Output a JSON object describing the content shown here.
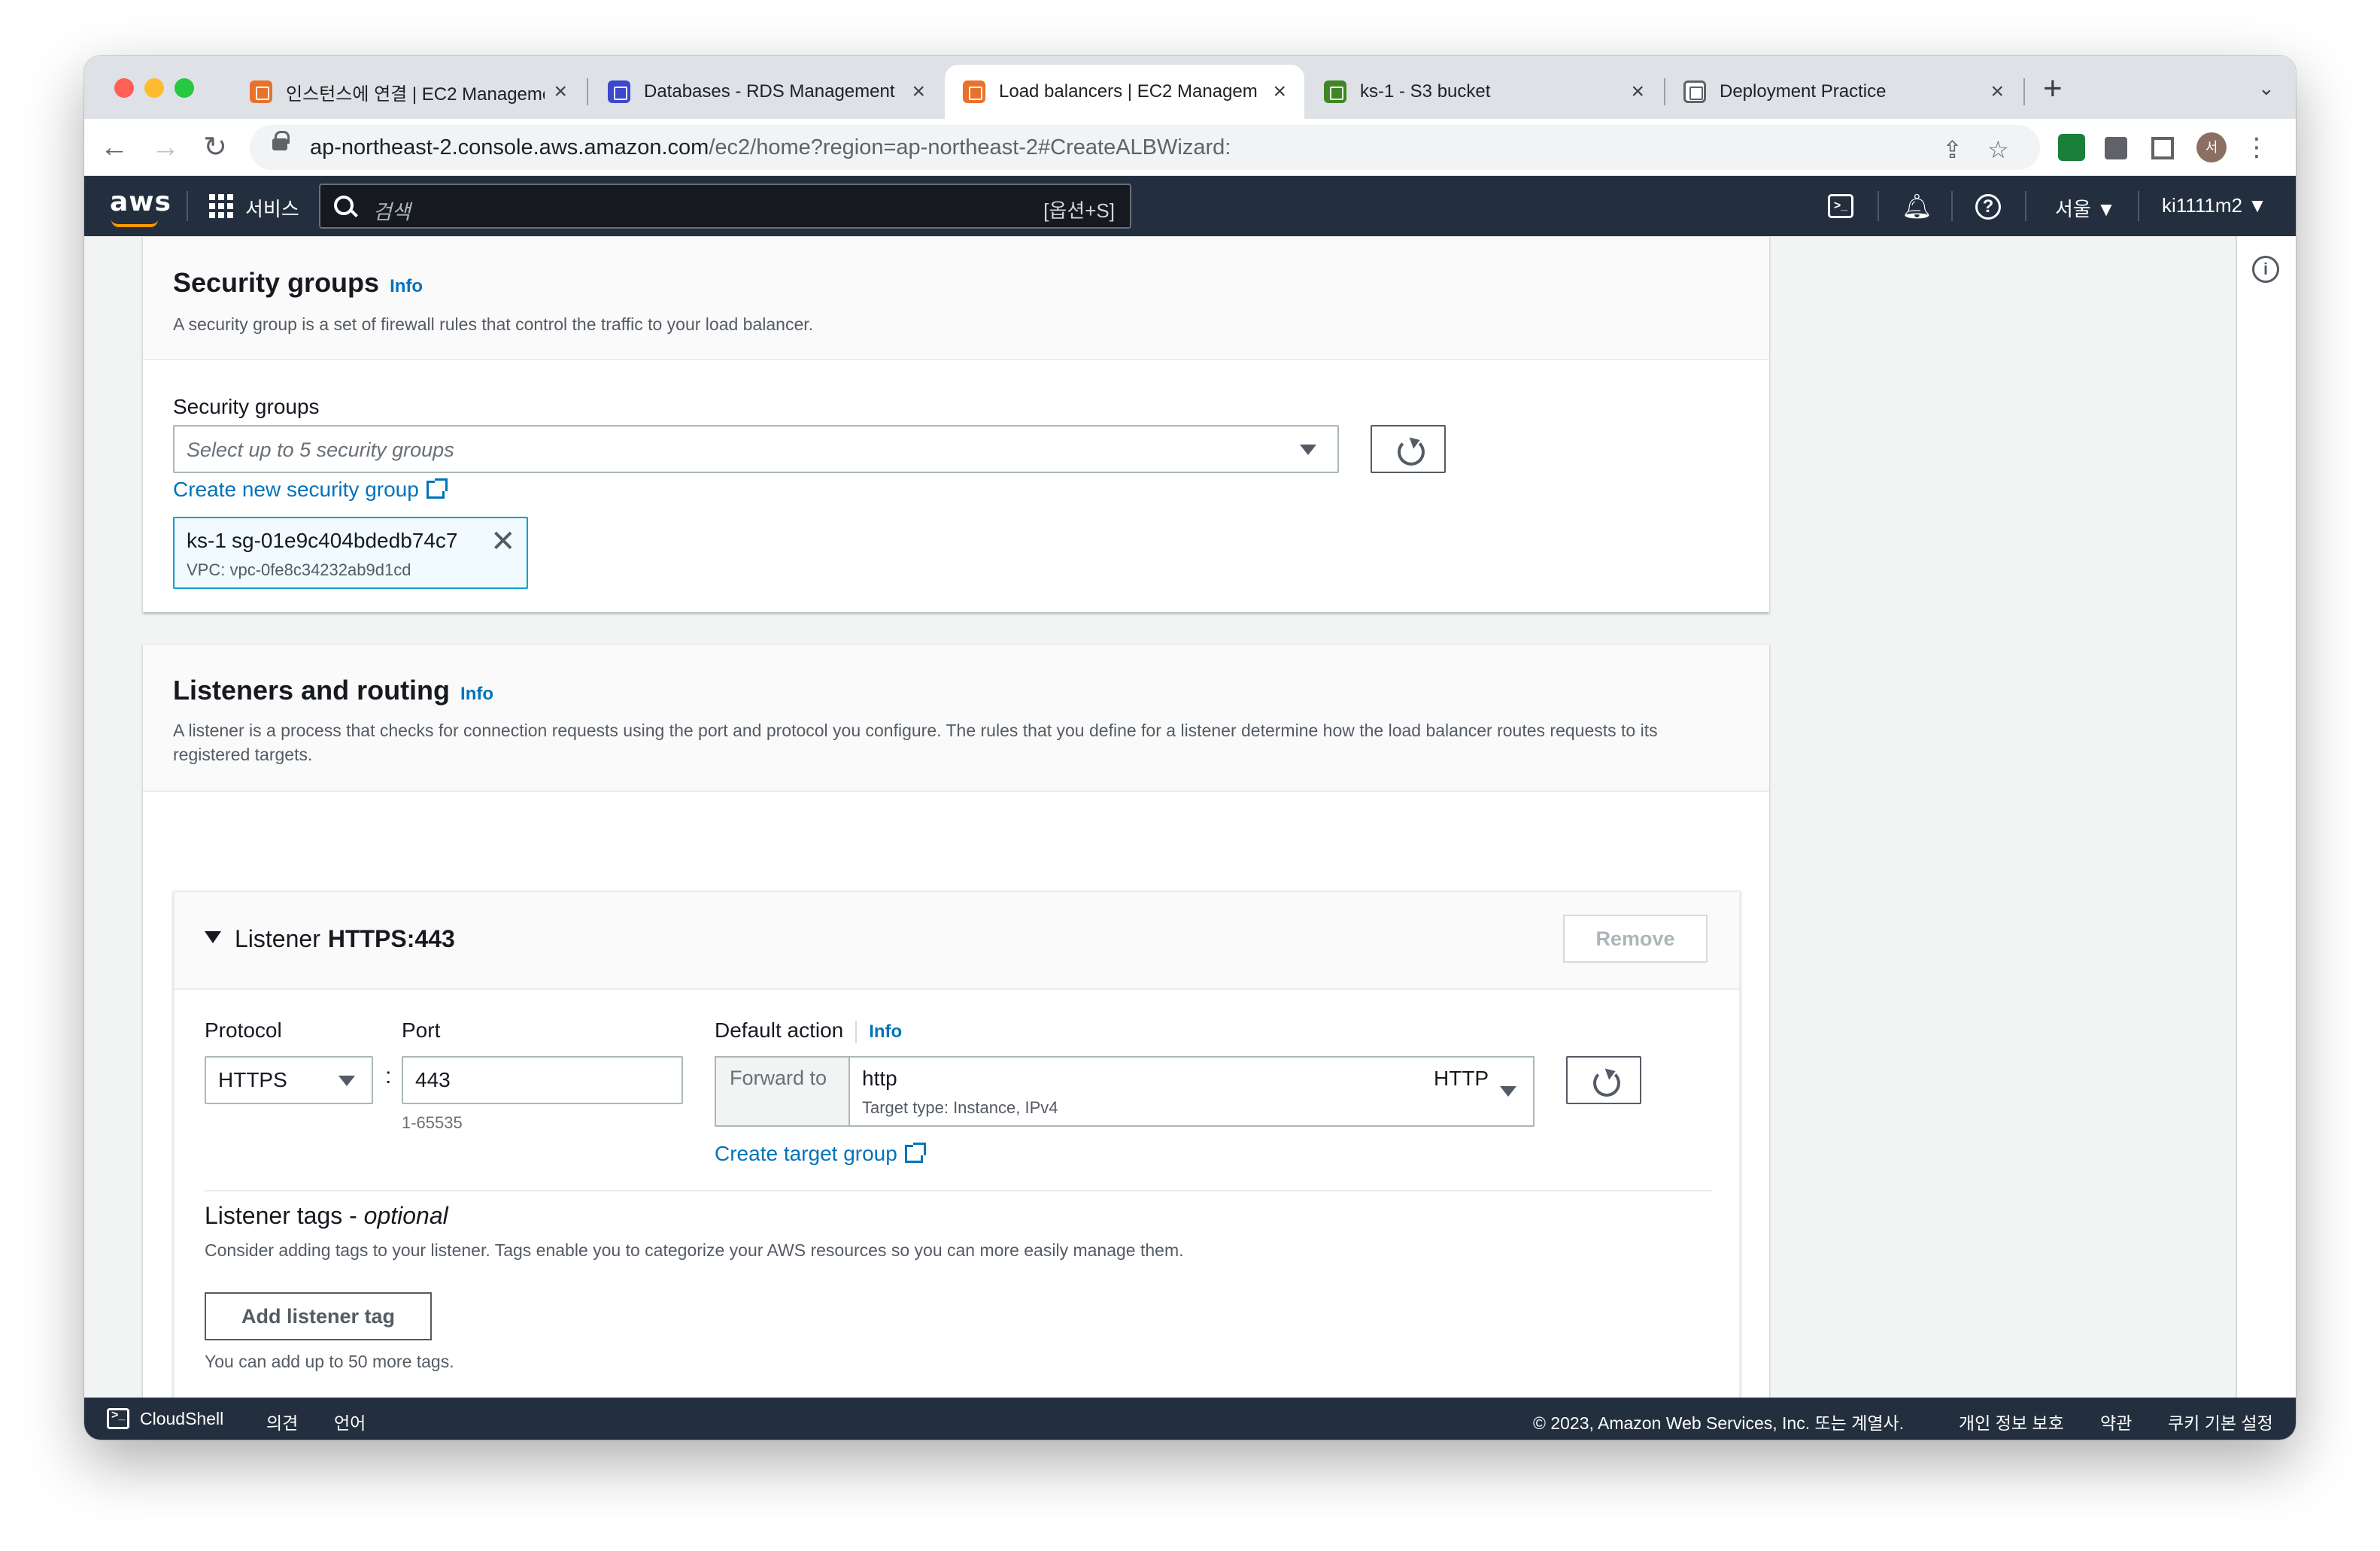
{
  "browser": {
    "tabs": [
      {
        "title": "인스턴스에 연결 | EC2 Manageme",
        "icon": "ec2-favicon"
      },
      {
        "title": "Databases - RDS Management",
        "icon": "rds-favicon"
      },
      {
        "title": "Load balancers | EC2 Managem",
        "icon": "ec2-favicon"
      },
      {
        "title": "ks-1 - S3 bucket",
        "icon": "s3-favicon"
      },
      {
        "title": "Deployment Practice",
        "icon": "doc-favicon"
      }
    ],
    "url_host": "ap-northeast-2.console.aws.amazon.com",
    "url_path": "/ec2/home?region=ap-northeast-2#CreateALBWizard:",
    "avatar_initial": "서"
  },
  "aws_nav": {
    "logo": "aws",
    "services_label": "서비스",
    "search_placeholder": "검색",
    "search_shortcut": "[옵션+S]",
    "region": "서울 ▼",
    "account": "ki1111m2 ▼"
  },
  "security_groups": {
    "title": "Security groups",
    "info": "Info",
    "description": "A security group is a set of firewall rules that control the traffic to your load balancer.",
    "field_label": "Security groups",
    "select_placeholder": "Select up to 5 security groups",
    "create_link": "Create new security group",
    "selected": {
      "name": "ks-1",
      "id": "sg-01e9c404bdedb74c7",
      "vpc": "VPC: vpc-0fe8c34232ab9d1cd"
    }
  },
  "listeners": {
    "title": "Listeners and routing",
    "info": "Info",
    "description": "A listener is a process that checks for connection requests using the port and protocol you configure. The rules that you define for a listener determine how the load balancer routes requests to its registered targets.",
    "listener": {
      "label": "Listener",
      "name": "HTTPS:443",
      "remove": "Remove",
      "protocol_label": "Protocol",
      "protocol_value": "HTTPS",
      "port_label": "Port",
      "port_value": "443",
      "port_hint": "1-65535",
      "colon": ":",
      "default_action_label": "Default action",
      "default_action_info": "Info",
      "forward_to": "Forward to",
      "target_name": "http",
      "target_type": "Target type: Instance, IPv4",
      "target_protocol": "HTTP",
      "create_target_link": "Create target group",
      "tags_title": "Listener tags - ",
      "tags_title_optional": "optional",
      "tags_description": "Consider adding tags to your listener. Tags enable you to categorize your AWS resources so you can more easily manage them.",
      "add_tag_button": "Add listener tag",
      "tags_hint": "You can add up to 50 more tags."
    }
  },
  "footer": {
    "cloudshell": "CloudShell",
    "feedback": "의견",
    "language": "언어",
    "copyright": "© 2023, Amazon Web Services, Inc. 또는 계열사.",
    "privacy": "개인 정보 보호",
    "terms": "약관",
    "cookies": "쿠키 기본 설정"
  }
}
